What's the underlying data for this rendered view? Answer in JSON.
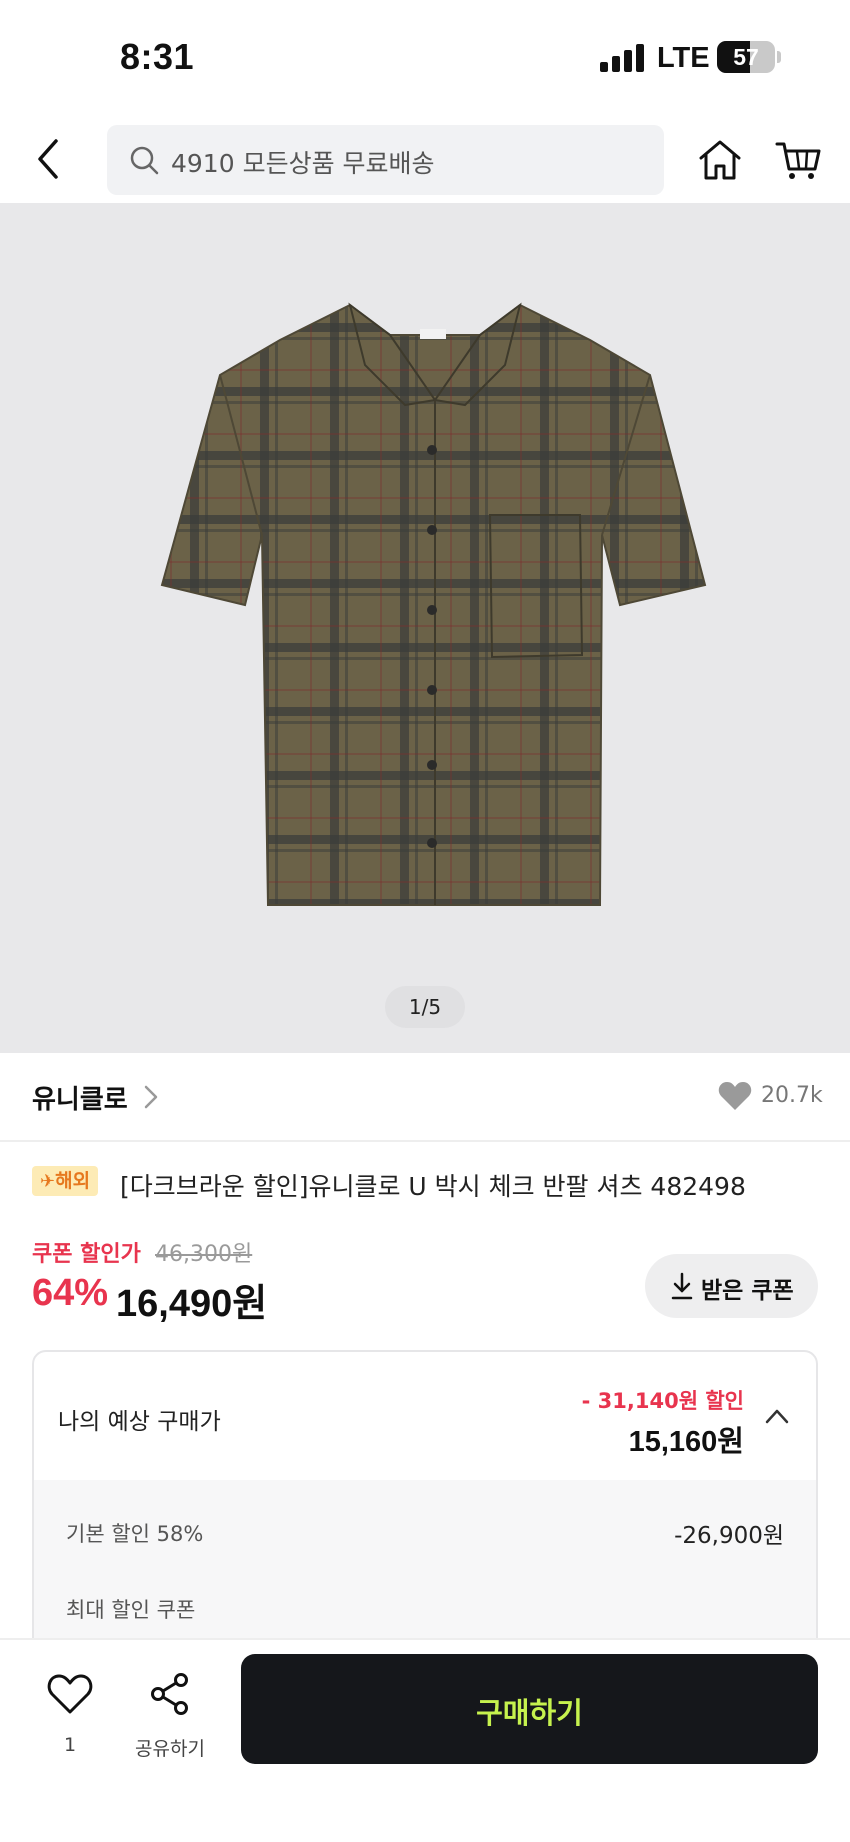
{
  "status_bar": {
    "time": "8:31",
    "network": "LTE",
    "battery_level": "57",
    "signal_bars": 4
  },
  "header": {
    "search_placeholder": "4910 모든상품 무료배송",
    "icons": [
      "back-icon",
      "search-icon",
      "home-icon",
      "cart-icon"
    ]
  },
  "gallery": {
    "counter": "1/5",
    "image": "olive-brown-plaid-short-sleeve-shirt"
  },
  "brand": {
    "name": "유니클로",
    "like_count": "20.7k"
  },
  "product": {
    "badge": "해외",
    "badge_icon": "✈",
    "title": "[다크브라운 할인]유니클로 U 박시 체크 반팔 셔츠 482498"
  },
  "price": {
    "coupon_label": "쿠폰 할인가",
    "original": "46,300원",
    "discount_rate": "64%",
    "sale": "16,490원",
    "coupon_button": "받은 쿠폰"
  },
  "estimate": {
    "label": "나의 예상 구매가",
    "discount_total": "- 31,140원 할인",
    "final_price": "15,160원",
    "rows": [
      {
        "label": "기본 할인 58%",
        "value": "-26,900원"
      },
      {
        "label": "최대 할인 쿠폰",
        "value": ""
      }
    ]
  },
  "bottom": {
    "wish_count": "1",
    "share_label": "공유하기",
    "buy_label": "구매하기"
  },
  "colors": {
    "accent_red": "#e8344e",
    "buy_button_bg": "#15171b",
    "buy_button_text": "#c6f24e",
    "badge_bg": "#fdebb5",
    "badge_text": "#e6781e"
  }
}
